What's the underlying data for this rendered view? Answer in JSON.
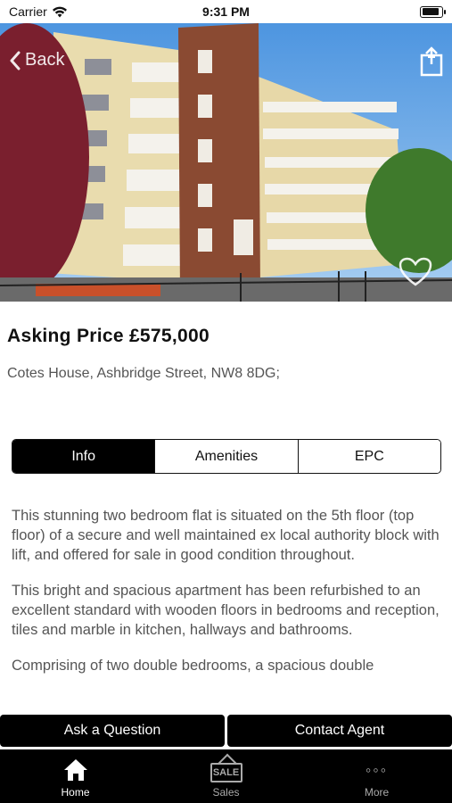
{
  "status_bar": {
    "carrier": "Carrier",
    "time": "9:31 PM",
    "battery_level": 0.9
  },
  "header": {
    "back_label": "Back"
  },
  "hero": {
    "icons": {
      "back": "chevron-left-icon",
      "share": "share-icon",
      "favorite": "heart-icon"
    }
  },
  "listing": {
    "price": "Asking Price £575,000",
    "address": "Cotes House, Ashbridge Street, NW8 8DG;"
  },
  "tabs": [
    {
      "label": "Info",
      "active": true
    },
    {
      "label": "Amenities",
      "active": false
    },
    {
      "label": "EPC",
      "active": false
    }
  ],
  "description": {
    "paragraphs": [
      "This stunning two bedroom flat is situated on the 5th floor (top floor) of a secure and well maintained ex local authority block with lift, and offered for sale in good condition throughout.",
      "This bright and spacious apartment has been refurbished to an excellent standard with wooden floors in bedrooms and reception, tiles and marble in kitchen, hallways and bathrooms.",
      "Comprising of two double bedrooms, a spacious double"
    ]
  },
  "actions": {
    "ask_label": "Ask a Question",
    "contact_label": "Contact Agent"
  },
  "bottom_nav": {
    "items": [
      {
        "label": "Home",
        "icon": "home-icon",
        "active": true
      },
      {
        "label": "Sales",
        "icon": "sale-sign-icon",
        "active": false,
        "sign_text": "SALE"
      },
      {
        "label": "More",
        "icon": "more-dots-icon",
        "active": false,
        "glyph": "◦◦◦"
      }
    ]
  },
  "colors": {
    "accent": "#000000",
    "text_secondary": "#555555",
    "sky": "#5aa0e6"
  }
}
